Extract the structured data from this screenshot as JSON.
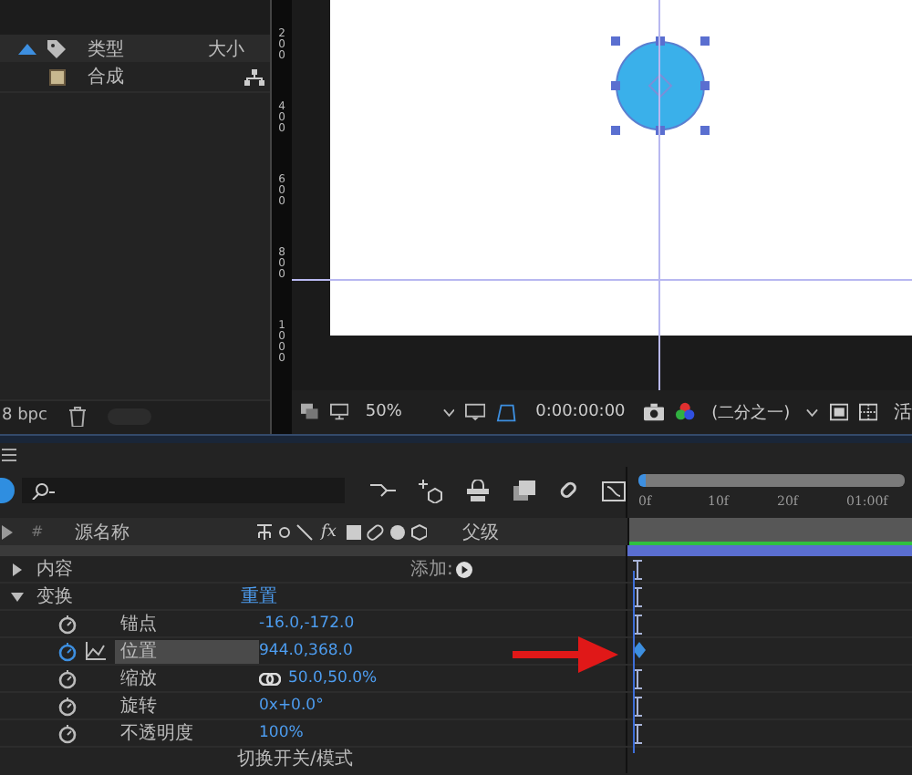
{
  "project_panel": {
    "columns": [
      {
        "label": "类型"
      },
      {
        "label": "大小"
      }
    ],
    "items": [
      {
        "name": "合成",
        "selected": false
      }
    ],
    "bit_depth": "8 bpc"
  },
  "viewer": {
    "ruler_labels": [
      "200",
      "400",
      "600",
      "800",
      "1000"
    ],
    "zoom": "50%",
    "timecode": "0:00:00:00",
    "resolution": "(二分之一)",
    "view": "活"
  },
  "timeline": {
    "columns": [
      "#",
      "源名称",
      "父级"
    ],
    "effects_switch": "fx",
    "ruler": [
      "0f",
      "10f",
      "20f",
      "01:00f"
    ],
    "properties": [
      {
        "kind": "group",
        "label": "内容",
        "expanded": false,
        "value": "添加:"
      },
      {
        "kind": "group",
        "label": "变换",
        "expanded": true,
        "value": "重置"
      },
      {
        "kind": "prop",
        "label": "锚点",
        "animated": false,
        "selected": false,
        "value": "-16.0,-172.0"
      },
      {
        "kind": "prop",
        "label": "位置",
        "animated": true,
        "selected": true,
        "value": "944.0,368.0"
      },
      {
        "kind": "prop",
        "label": "缩放",
        "animated": false,
        "selected": false,
        "value": "50.0,50.0%",
        "linked": true
      },
      {
        "kind": "prop",
        "label": "旋转",
        "animated": false,
        "selected": false,
        "value": "0x+0.0°"
      },
      {
        "kind": "prop",
        "label": "不透明度",
        "animated": false,
        "selected": false,
        "value": "100%"
      }
    ],
    "footer": "切换开关/模式"
  }
}
